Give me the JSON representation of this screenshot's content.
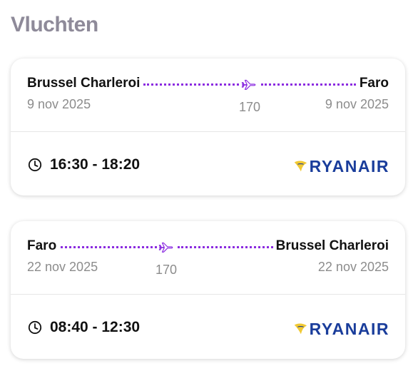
{
  "section_title": "Vluchten",
  "flights": [
    {
      "origin": "Brussel Charleroi",
      "origin_date": "9 nov 2025",
      "destination": "Faro",
      "destination_date": "9 nov 2025",
      "count": "170",
      "time": "16:30 - 18:20",
      "airline": "RYANAIR"
    },
    {
      "origin": "Faro",
      "origin_date": "22 nov 2025",
      "destination": "Brussel Charleroi",
      "destination_date": "22 nov 2025",
      "count": "170",
      "time": "08:40 - 12:30",
      "airline": "RYANAIR"
    }
  ],
  "icons": {
    "route": "plane-icon",
    "time": "clock-icon",
    "airline": "ryanair-harp-logo"
  },
  "colors": {
    "accent": "#8b2be0",
    "title": "#8e8a99",
    "muted": "#8c8c8c",
    "airline": "#1a3d9b",
    "logo_yellow": "#f1c933"
  }
}
